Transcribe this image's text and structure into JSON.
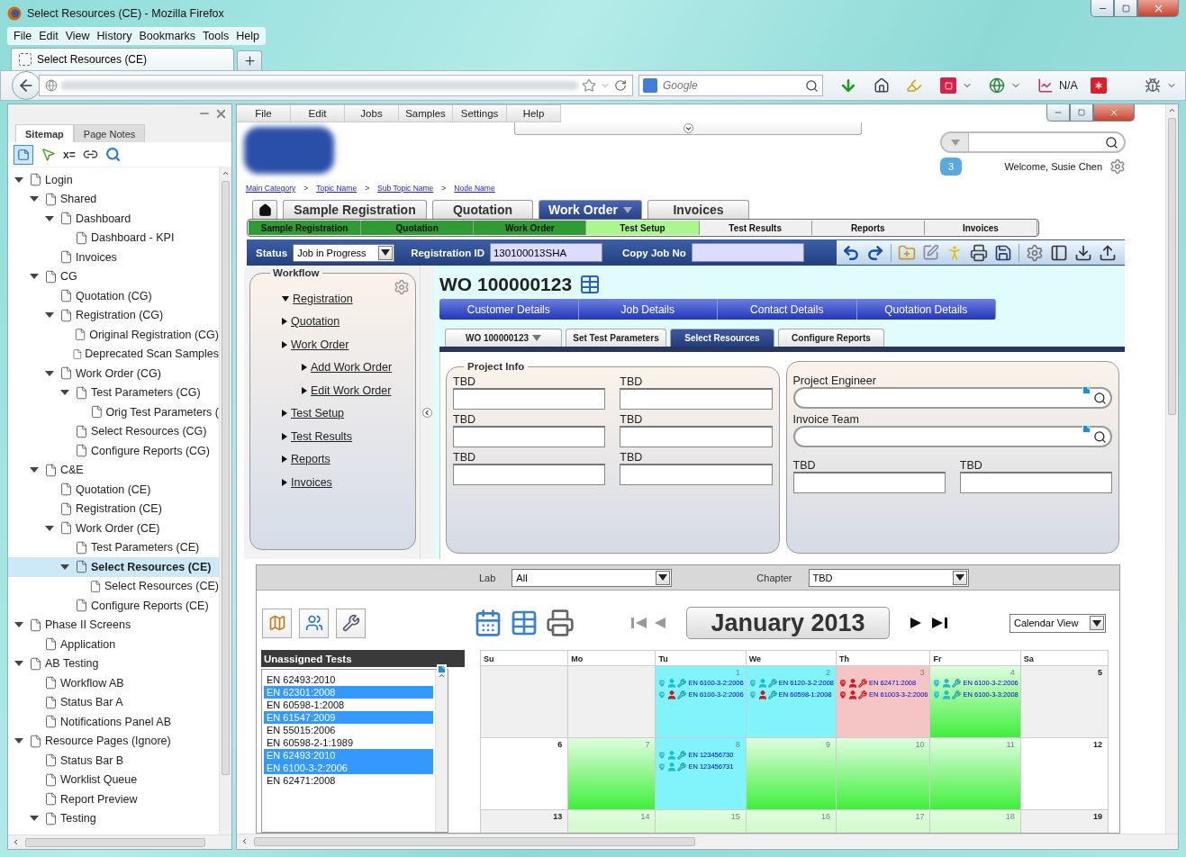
{
  "window": {
    "title": "Select Resources (CE) - Mozilla Firefox"
  },
  "menu": [
    "File",
    "Edit",
    "View",
    "History",
    "Bookmarks",
    "Tools",
    "Help"
  ],
  "browser_tabs": [
    {
      "label": "Select Resources (CE)",
      "selected": true
    }
  ],
  "search_engine": {
    "placeholder": "Google"
  },
  "toolbar_status": "N/A",
  "sidebar": {
    "tabs": [
      {
        "label": "Sitemap",
        "selected": true
      },
      {
        "label": "Page Notes",
        "selected": false
      }
    ],
    "variable_button": "x=",
    "tree": [
      {
        "label": "Login",
        "expanded": true,
        "selected": false,
        "children": [
          {
            "label": "Shared",
            "expanded": true,
            "selected": false,
            "children": [
              {
                "label": "Dashboard",
                "expanded": true,
                "selected": false,
                "children": [
                  {
                    "label": "Dashboard - KPI",
                    "selected": false
                  }
                ]
              },
              {
                "label": "Invoices",
                "selected": false
              }
            ]
          },
          {
            "label": "CG",
            "expanded": true,
            "selected": false,
            "children": [
              {
                "label": "Quotation (CG)",
                "selected": false
              },
              {
                "label": "Registration (CG)",
                "expanded": true,
                "selected": false,
                "children": [
                  {
                    "label": "Original Registration (CG)",
                    "selected": false
                  },
                  {
                    "label": "Deprecated Scan Samples",
                    "selected": false
                  }
                ]
              },
              {
                "label": "Work Order (CG)",
                "expanded": true,
                "selected": false,
                "children": [
                  {
                    "label": "Test Parameters (CG)",
                    "expanded": true,
                    "selected": false,
                    "children": [
                      {
                        "label": "Orig Test Parameters (",
                        "selected": false
                      }
                    ]
                  },
                  {
                    "label": "Select Resources (CG)",
                    "selected": false
                  },
                  {
                    "label": "Configure Reports (CG)",
                    "selected": false
                  }
                ]
              }
            ]
          },
          {
            "label": "C&E",
            "expanded": true,
            "selected": false,
            "children": [
              {
                "label": "Quotation (CE)",
                "selected": false
              },
              {
                "label": "Registration (CE)",
                "selected": false
              },
              {
                "label": "Work Order (CE)",
                "expanded": true,
                "selected": false,
                "children": [
                  {
                    "label": "Test Parameters (CE)",
                    "selected": false
                  },
                  {
                    "label": "Select Resources (CE)",
                    "expanded": true,
                    "selected": true,
                    "children": [
                      {
                        "label": "Select Resources (CE)",
                        "selected": false
                      }
                    ]
                  },
                  {
                    "label": "Configure Reports (CE)",
                    "selected": false
                  }
                ]
              }
            ]
          }
        ]
      },
      {
        "label": "Phase II Screens",
        "expanded": true,
        "selected": false,
        "children": [
          {
            "label": "Application",
            "selected": false
          }
        ]
      },
      {
        "label": "AB Testing",
        "expanded": true,
        "selected": false,
        "children": [
          {
            "label": "Workflow AB",
            "selected": false
          },
          {
            "label": "Status Bar A",
            "selected": false
          },
          {
            "label": "Notifications Panel AB",
            "selected": false
          }
        ]
      },
      {
        "label": "Resource Pages (Ignore)",
        "expanded": true,
        "selected": false,
        "children": [
          {
            "label": "Status Bar B",
            "selected": false
          },
          {
            "label": "Worklist Queue",
            "selected": false
          },
          {
            "label": "Report Preview",
            "selected": false
          },
          {
            "label": "Testing",
            "expanded": true,
            "selected": false
          }
        ]
      }
    ]
  },
  "app": {
    "menu": [
      "File",
      "Edit",
      "Jobs",
      "Samples",
      "Settings",
      "Help"
    ],
    "notifications": "3",
    "welcome": "Welcome, Susie Chen",
    "breadcrumb": [
      {
        "kind": "link",
        "label": "Main Category"
      },
      {
        "kind": "separator",
        "label": ">"
      },
      {
        "kind": "link",
        "label": "Topic Name"
      },
      {
        "kind": "separator",
        "label": ">"
      },
      {
        "kind": "link",
        "label": "Sub Topic Name"
      },
      {
        "kind": "separator",
        "label": ">"
      },
      {
        "kind": "link",
        "label": "Node Name"
      }
    ],
    "main_tabs": [
      {
        "label": "Sample Registration",
        "selected": false,
        "dropdown": false
      },
      {
        "label": "Quotation",
        "selected": false,
        "dropdown": false
      },
      {
        "label": "Work Order",
        "selected": true,
        "dropdown": true
      },
      {
        "label": "Invoices",
        "selected": false,
        "dropdown": false
      }
    ],
    "steps": [
      {
        "label": "Sample Registration",
        "kind": "done"
      },
      {
        "label": "Quotation",
        "kind": "done"
      },
      {
        "label": "Work Order",
        "kind": "done"
      },
      {
        "label": "Test Setup",
        "kind": "current"
      },
      {
        "label": "Test Results",
        "kind": "pending"
      },
      {
        "label": "Reports",
        "kind": "pending"
      },
      {
        "label": "Invoices",
        "kind": "pending"
      }
    ],
    "status_bar": {
      "status_label": "Status",
      "status_value": "Job in Progress",
      "registration_label": "Registration ID",
      "registration_value": "130100013SHA",
      "copy_label": "Copy Job No"
    },
    "workflow": {
      "title": "Workflow",
      "items": [
        {
          "label": "Registration",
          "expanded": true
        },
        {
          "label": "Quotation",
          "expanded": false
        },
        {
          "label": "Work Order",
          "expanded": false,
          "children": [
            {
              "label": "Add Work Order",
              "expanded": false
            },
            {
              "label": "Edit Work Order",
              "expanded": false
            }
          ]
        },
        {
          "label": "Test Setup",
          "expanded": false
        },
        {
          "label": "Test Results",
          "expanded": false
        },
        {
          "label": "Reports",
          "expanded": false
        },
        {
          "label": "Invoices",
          "expanded": false
        }
      ]
    },
    "work_order": {
      "title": "WO 100000123",
      "detail_tabs": [
        "Customer Details",
        "Job Details",
        "Contact Details",
        "Quotation Details"
      ],
      "sub_tabs": [
        {
          "label": "WO 100000123",
          "selected": false,
          "dropdown": true
        },
        {
          "label": "Set Test Parameters",
          "selected": false,
          "dropdown": false
        },
        {
          "label": "Select Resources",
          "selected": true,
          "dropdown": false
        },
        {
          "label": "Configure Reports",
          "selected": false,
          "dropdown": false
        }
      ]
    },
    "project_info": {
      "title": "Project Info",
      "fields": [
        {
          "label": "TBD"
        },
        {
          "label": "TBD"
        },
        {
          "label": "TBD"
        },
        {
          "label": "TBD"
        },
        {
          "label": "TBD"
        },
        {
          "label": "TBD"
        }
      ]
    },
    "resources": {
      "lookups": [
        {
          "label": "Project Engineer"
        },
        {
          "label": "Invoice Team"
        }
      ],
      "fields": [
        {
          "label": "TBD"
        },
        {
          "label": "TBD"
        }
      ]
    },
    "filters": [
      {
        "label": "Lab",
        "value": "All"
      },
      {
        "label": "Chapter",
        "value": "TBD"
      }
    ],
    "month": "January 2013",
    "view": "Calendar View",
    "unassigned": {
      "title": "Unassigned Tests",
      "items": [
        {
          "label": "EN 62493:2010",
          "selected": false
        },
        {
          "label": "EN 62301:2008",
          "selected": true
        },
        {
          "label": "EN 60598-1:2008",
          "selected": false
        },
        {
          "label": "EN 61547:2009",
          "selected": true
        },
        {
          "label": "EN 55015:2006",
          "selected": false
        },
        {
          "label": "EN 60598-2-1:1989",
          "selected": false
        },
        {
          "label": "EN 62493:2010",
          "selected": true
        },
        {
          "label": "EN 6100-3-2:2006",
          "selected": true
        },
        {
          "label": "EN 62471:2008",
          "selected": false
        }
      ]
    },
    "calendar": {
      "days": [
        "Su",
        "Mo",
        "Tu",
        "We",
        "Th",
        "Fr",
        "Sa"
      ],
      "weeks": [
        [
          {
            "kind": "closed"
          },
          {
            "kind": "closed"
          },
          {
            "day": "1",
            "kind": "assigned",
            "entries": [
              {
                "label": "EN 6100-3-2:2006",
                "kind": "ok"
              },
              {
                "label": "EN 6100-3-2:2006",
                "kind": "partial"
              }
            ]
          },
          {
            "day": "2",
            "kind": "assigned",
            "entries": [
              {
                "label": "EN 6120-3-2:2008",
                "kind": "ok"
              },
              {
                "label": "EN 60598-1:2008",
                "kind": "partial"
              }
            ]
          },
          {
            "day": "3",
            "kind": "conflict",
            "entries": [
              {
                "label": "EN 62471:2008",
                "kind": "conflict"
              },
              {
                "label": "EN 61003-3-2:2006",
                "kind": "conflict"
              }
            ]
          },
          {
            "day": "4",
            "kind": "available",
            "entries": [
              {
                "label": "EN 6100-3-2:2006",
                "kind": "ok"
              },
              {
                "label": "EN 6100-3-3:2008",
                "kind": "ok"
              }
            ]
          },
          {
            "day": "5",
            "kind": "closed"
          }
        ],
        [
          {
            "day": "6",
            "kind": "open"
          },
          {
            "day": "7",
            "kind": "available"
          },
          {
            "day": "8",
            "kind": "assigned",
            "entries": [
              {
                "label": "EN 123456730",
                "kind": "ok"
              },
              {
                "label": "EN 123456731",
                "kind": "ok"
              }
            ]
          },
          {
            "day": "9",
            "kind": "available"
          },
          {
            "day": "10",
            "kind": "available"
          },
          {
            "day": "11",
            "kind": "available"
          },
          {
            "day": "12",
            "kind": "open"
          }
        ],
        [
          {
            "day": "13",
            "kind": "closed"
          },
          {
            "day": "14",
            "kind": "tentative"
          },
          {
            "day": "15",
            "kind": "tentative"
          },
          {
            "day": "16",
            "kind": "tentative"
          },
          {
            "day": "17",
            "kind": "tentative"
          },
          {
            "day": "18",
            "kind": "tentative"
          },
          {
            "day": "19",
            "kind": "closed"
          }
        ]
      ]
    }
  }
}
